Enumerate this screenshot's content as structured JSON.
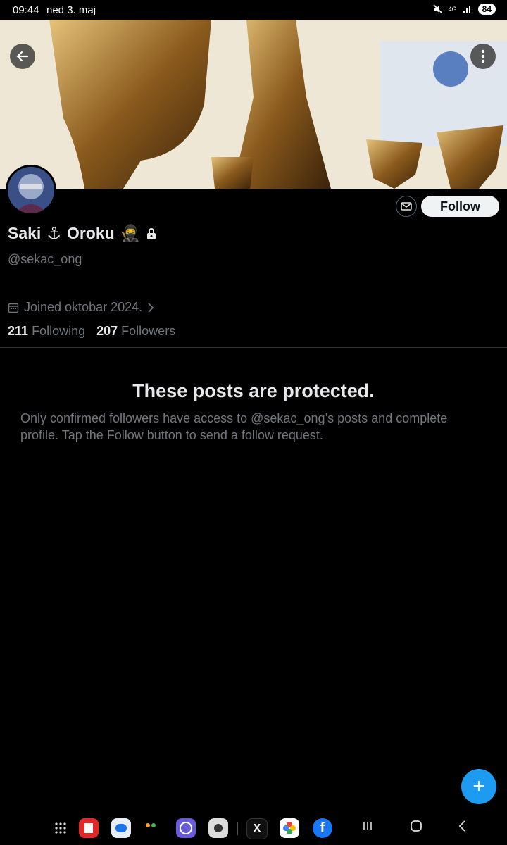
{
  "status_bar": {
    "time": "09:44",
    "date": "ned 3. maj",
    "network": "4G",
    "battery": "84"
  },
  "banner": {
    "back_icon": "arrow-left-icon",
    "more_icon": "more-vertical-icon"
  },
  "profile": {
    "display_name": "Saki",
    "name_emoji_1": "⚓",
    "name_part_2": "Oroku",
    "name_emoji_2": "🥷",
    "handle": "@sekac_ong",
    "joined": "Joined oktobar 2024.",
    "following_count": "211",
    "following_label": "Following",
    "followers_count": "207",
    "followers_label": "Followers",
    "follow_button": "Follow"
  },
  "protected": {
    "title": "These posts are protected.",
    "text": "Only confirmed followers have access to @sekac_ong’s posts and complete profile. Tap the Follow button to send a follow request."
  },
  "fab": {
    "icon": "plus-icon",
    "label": "+"
  },
  "colors": {
    "accent": "#1d9bf0",
    "secondary_text": "#71767b",
    "background": "#000000"
  },
  "dock": {
    "apps": [
      "app-grid-icon",
      "flipboard-icon",
      "messages-icon",
      "multi-app-icon",
      "browser-icon",
      "camera-icon",
      "x-icon",
      "photos-icon",
      "facebook-icon"
    ],
    "nav": [
      "recents-icon",
      "home-icon",
      "back-nav-icon"
    ]
  }
}
